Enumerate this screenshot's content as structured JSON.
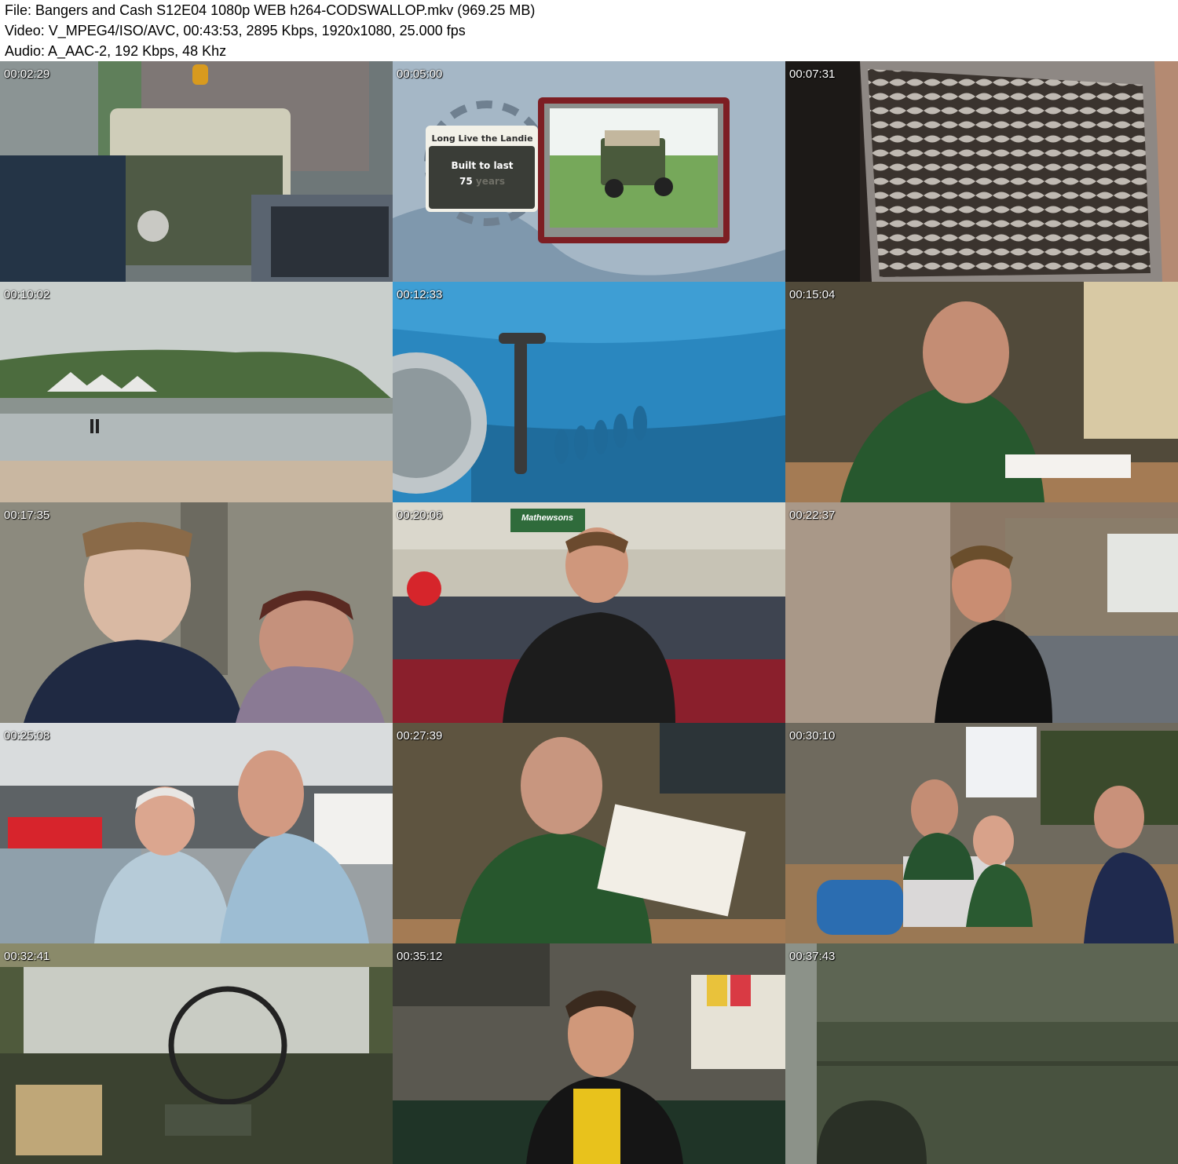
{
  "header": {
    "file_line": "File: Bangers and Cash S12E04 1080p WEB h264-CODSWALLOP.mkv (969.25 MB)",
    "video_line": "Video: V_MPEG4/ISO/AVC, 00:43:53, 2895 Kbps, 1920x1080, 25.000 fps",
    "audio_line": "Audio: A_AAC-2, 192 Kbps, 48 Khz"
  },
  "thumbnails": [
    {
      "timestamp": "00:02:29",
      "scene": "land-rover-in-car-park"
    },
    {
      "timestamp": "00:05:00",
      "scene": "infographic-card",
      "card_title": "Long Live the Landie",
      "card_line1": "Built to last",
      "card_number": "75",
      "card_unit": "years"
    },
    {
      "timestamp": "00:07:31",
      "scene": "chrome-grille-closeup"
    },
    {
      "timestamp": "00:10:02",
      "scene": "beach-and-headland"
    },
    {
      "timestamp": "00:12:33",
      "scene": "blue-bonnet-clasp"
    },
    {
      "timestamp": "00:15:04",
      "scene": "auctioneer-with-headset"
    },
    {
      "timestamp": "00:17:35",
      "scene": "girl-and-woman"
    },
    {
      "timestamp": "00:20:06",
      "scene": "man-in-showroom",
      "sign_text": "Mathewsons"
    },
    {
      "timestamp": "00:22:37",
      "scene": "man-in-workshop"
    },
    {
      "timestamp": "00:25:08",
      "scene": "couple-outdoors"
    },
    {
      "timestamp": "00:27:39",
      "scene": "auctioneer-reading-paper"
    },
    {
      "timestamp": "00:30:10",
      "scene": "auction-desk"
    },
    {
      "timestamp": "00:32:41",
      "scene": "old-steering-wheel"
    },
    {
      "timestamp": "00:35:12",
      "scene": "man-on-sofa"
    },
    {
      "timestamp": "00:37:43",
      "scene": "green-vehicle-panel"
    }
  ],
  "colors": {
    "background": "#ffffff",
    "timestamp_text": "#ffffff"
  }
}
